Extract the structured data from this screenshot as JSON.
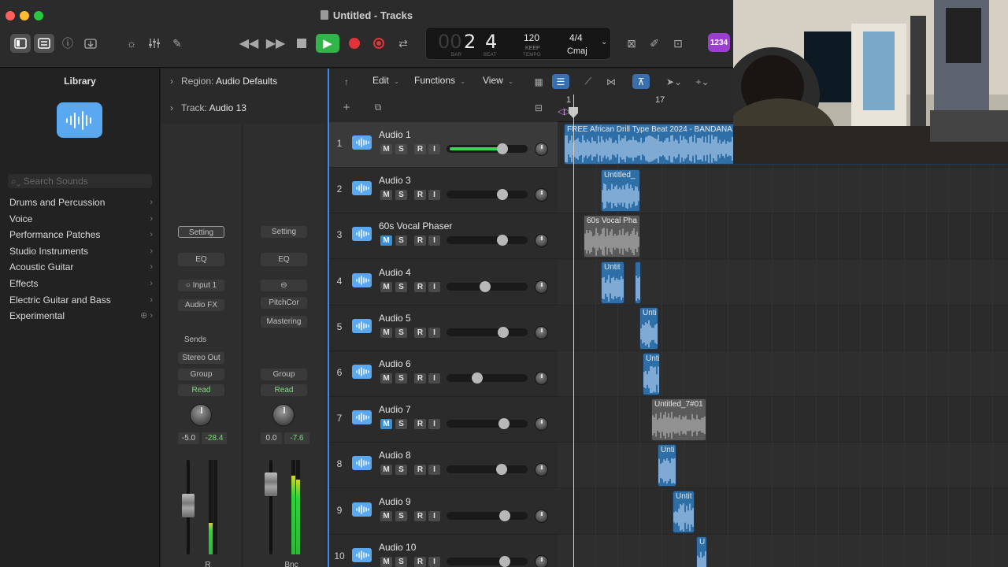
{
  "window": {
    "title": "Untitled - Tracks",
    "traffic": {
      "close": "#ff5f57",
      "minimize": "#febc2e",
      "zoom": "#28c840"
    }
  },
  "lcd": {
    "bar": "2",
    "beat": "4",
    "bar_dim": "00",
    "bar_label": "BAR",
    "beat_label": "BEAT",
    "tempo": "120",
    "tempo_mode": "KEEP",
    "tempo_label": "TEMPO",
    "time_sig": "4/4",
    "key": "Cmaj"
  },
  "badge": "1234",
  "library": {
    "title": "Library",
    "search_placeholder": "Search Sounds",
    "items": [
      "Drums and Percussion",
      "Voice",
      "Performance Patches",
      "Studio Instruments",
      "Acoustic Guitar",
      "Effects",
      "Electric Guitar and Bass",
      "Experimental"
    ]
  },
  "inspector": {
    "region_label": "Region:",
    "region_value": "Audio Defaults",
    "track_label": "Track:",
    "track_value": "Audio 13",
    "strip1": {
      "setting": "Setting",
      "eq": "EQ",
      "input": "Input 1",
      "audio_fx": "Audio FX",
      "sends": "Sends",
      "output": "Stereo Out",
      "group": "Group",
      "automation": "Read",
      "pan_val": "-5.0",
      "peak_val": "-28.4",
      "fader_label": "R"
    },
    "strip2": {
      "setting": "Setting",
      "eq": "EQ",
      "plugin1": "PitchCor",
      "plugin2": "Mastering",
      "group": "Group",
      "automation": "Read",
      "pan_val": "0.0",
      "peak_val": "-7.6",
      "fader_label": "Bnc"
    }
  },
  "toolbar": {
    "edit": "Edit",
    "functions": "Functions",
    "view": "View"
  },
  "ruler": {
    "bar1": "1",
    "bar17": "17"
  },
  "tracks": [
    {
      "num": "1",
      "name": "Audio 1",
      "volume": 0.7,
      "mute": false,
      "selected": true
    },
    {
      "num": "2",
      "name": "Audio 3",
      "volume": 0.7,
      "mute": false,
      "selected": false
    },
    {
      "num": "3",
      "name": "60s Vocal Phaser",
      "volume": 0.7,
      "mute": true,
      "selected": false
    },
    {
      "num": "4",
      "name": "Audio 4",
      "volume": 0.45,
      "mute": false,
      "selected": false
    },
    {
      "num": "5",
      "name": "Audio 5",
      "volume": 0.72,
      "mute": false,
      "selected": false
    },
    {
      "num": "6",
      "name": "Audio 6",
      "volume": 0.33,
      "mute": false,
      "selected": false
    },
    {
      "num": "7",
      "name": "Audio 7",
      "volume": 0.73,
      "mute": true,
      "selected": false
    },
    {
      "num": "8",
      "name": "Audio 8",
      "volume": 0.69,
      "mute": false,
      "selected": false
    },
    {
      "num": "9",
      "name": "Audio 9",
      "volume": 0.74,
      "mute": false,
      "selected": false
    },
    {
      "num": "10",
      "name": "Audio 10",
      "volume": 0.74,
      "mute": false,
      "selected": false
    }
  ],
  "track_buttons": {
    "m": "M",
    "s": "S",
    "r": "R",
    "i": "I"
  },
  "regions": [
    {
      "name": "FREE African Drill Type Beat 2024 - BANDANA"
    },
    {
      "name": "Untitled_"
    },
    {
      "name": "60s Vocal Pha"
    },
    {
      "name": "Untit"
    },
    {
      "name": ""
    },
    {
      "name": "Unti"
    },
    {
      "name": "Unti"
    },
    {
      "name": "Untitled_7#01"
    },
    {
      "name": "Unti"
    },
    {
      "name": "Untit"
    },
    {
      "name": "U"
    }
  ]
}
